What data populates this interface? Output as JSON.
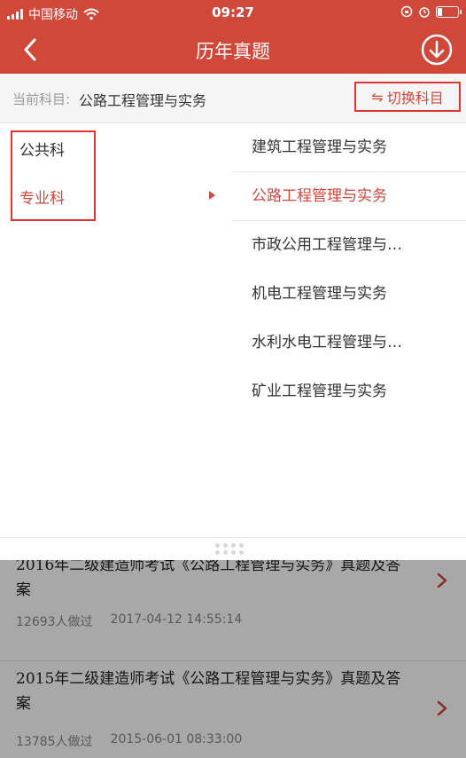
{
  "status_bar": {
    "carrier": "中国移动",
    "time": "09:27"
  },
  "nav": {
    "title": "历年真题"
  },
  "subject": {
    "label": "当前科目:",
    "value": "公路工程管理与实务",
    "switch_label": "切换科目",
    "switch_icon": "⇋"
  },
  "categories": [
    {
      "label": "公共科",
      "active": false
    },
    {
      "label": "专业科",
      "active": true
    }
  ],
  "subjects": [
    {
      "label": "建筑工程管理与实务",
      "active": false
    },
    {
      "label": "公路工程管理与实务",
      "active": true
    },
    {
      "label": "市政公用工程管理与实务",
      "active": false
    },
    {
      "label": "机电工程管理与实务",
      "active": false
    },
    {
      "label": "水利水电工程管理与实务",
      "active": false
    },
    {
      "label": "矿业工程管理与实务",
      "active": false
    }
  ],
  "papers": [
    {
      "title": "2016年二级建造师考试《公路工程管理与实务》真题及答案",
      "count": "12693人做过",
      "date": "2017-04-12 14:55:14"
    },
    {
      "title": "2015年二级建造师考试《公路工程管理与实务》真题及答案",
      "count": "13785人做过",
      "date": "2015-06-01 08:33:00"
    }
  ],
  "colors": {
    "brand": "#d0483a",
    "highlight_box": "#e03535"
  },
  "icons": [
    "wifi-icon",
    "back-icon",
    "download-icon",
    "chevron-right-icon",
    "drag-handle-icon"
  ]
}
